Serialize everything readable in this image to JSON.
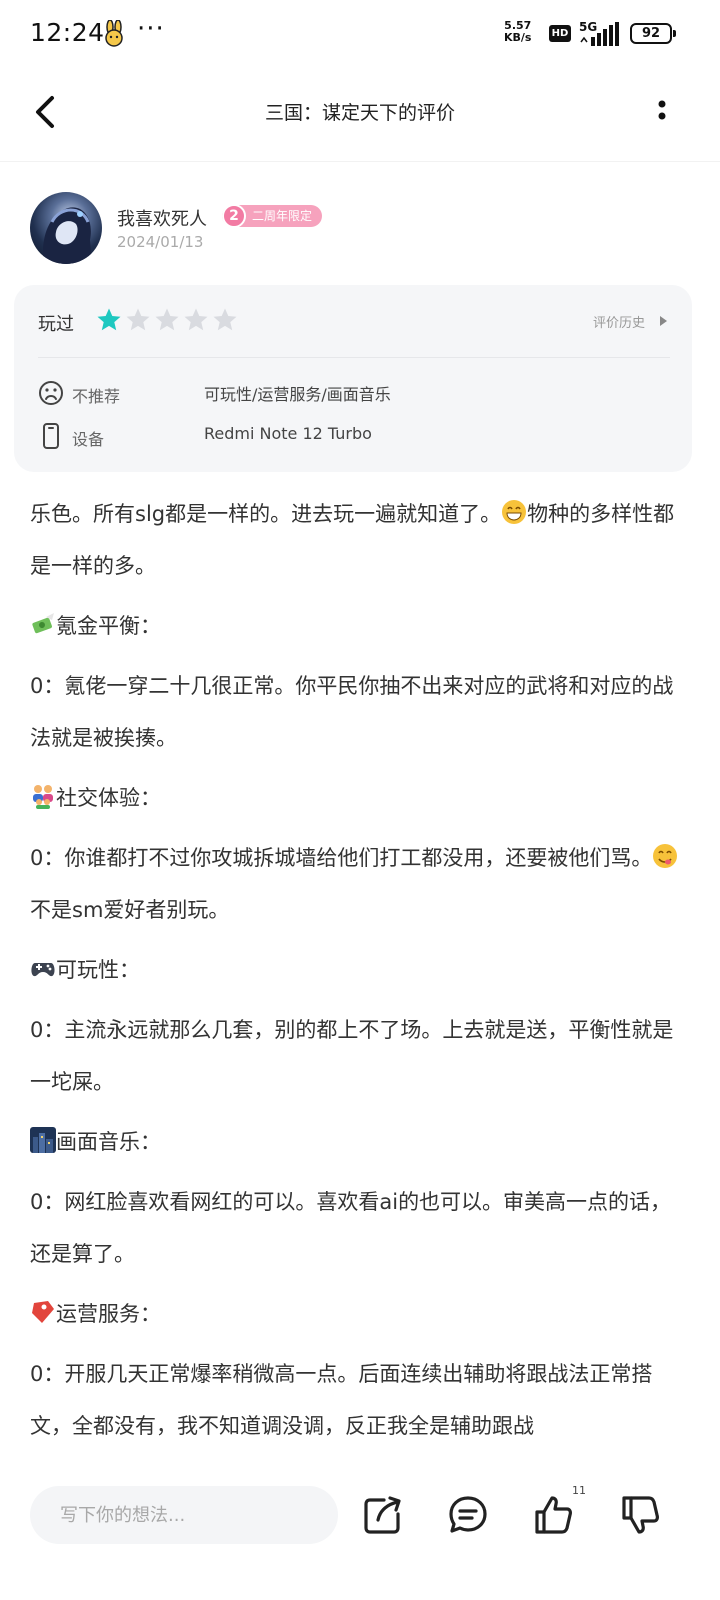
{
  "status_bar": {
    "time": "12:24",
    "network_speed_value": "5.57",
    "network_speed_unit": "KB/s",
    "hd_label": "HD",
    "network_type": "5G",
    "battery": "92"
  },
  "header": {
    "title": "三国：谋定天下的评价"
  },
  "review_author": {
    "name": "我喜欢死人",
    "badge_number": "2",
    "badge_text": "二周年限定",
    "date": "2024/01/13"
  },
  "rating_card": {
    "played_label": "玩过",
    "stars_filled": 1,
    "stars_total": 5,
    "history_label": "评价历史",
    "not_recommend_label": "不推荐",
    "not_recommend_value": "可玩性/运营服务/画面音乐",
    "device_label": "设备",
    "device_value": "Redmi Note 12 Turbo"
  },
  "review_body": {
    "p1_a": "乐色。所有slg都是一样的。进去玩一遍就知道了。",
    "p1_b": "物种的多样性都是一样的多。",
    "h1": "氪金平衡：",
    "p2": "0：氪佬一穿二十几很正常。你平民你抽不出来对应的武将和对应的战法就是被挨揍。",
    "h2": "社交体验：",
    "p3_a": "0：你谁都打不过你攻城拆城墙给他们打工都没用，还要被他们骂。",
    "p3_b": "不是sm爱好者别玩。",
    "h3": "可玩性：",
    "p4": "0：主流永远就那么几套，别的都上不了场。上去就是送，平衡性就是一坨屎。",
    "h4": "画面音乐：",
    "p5": "0：网红脸喜欢看网红的可以。喜欢看ai的也可以。审美高一点的话，还是算了。",
    "h5": "运营服务：",
    "p6": "0：开服几天正常爆率稍微高一点。后面连续出辅助将跟战法正常搭文，全都没有，我不知道调没调，反正我全是辅助跟战"
  },
  "bottom_bar": {
    "comment_placeholder": "写下你的想法...",
    "like_count": "11"
  },
  "colors": {
    "star_filled": "#1ec8c0",
    "star_empty": "#d9dbe0",
    "badge_pink": "#f6a2bd",
    "card_bg": "#f5f6f8"
  },
  "icons": [
    "back-arrow-icon",
    "more-vertical-icon",
    "sad-face-icon",
    "phone-icon",
    "chevron-right-icon",
    "share-icon",
    "comment-icon",
    "thumbs-up-icon",
    "thumbs-down-icon",
    "grinning-emoji-icon",
    "money-wings-emoji-icon",
    "family-emoji-icon",
    "gamepad-emoji-icon",
    "night-city-emoji-icon",
    "bookmark-emoji-icon",
    "yum-emoji-icon"
  ]
}
